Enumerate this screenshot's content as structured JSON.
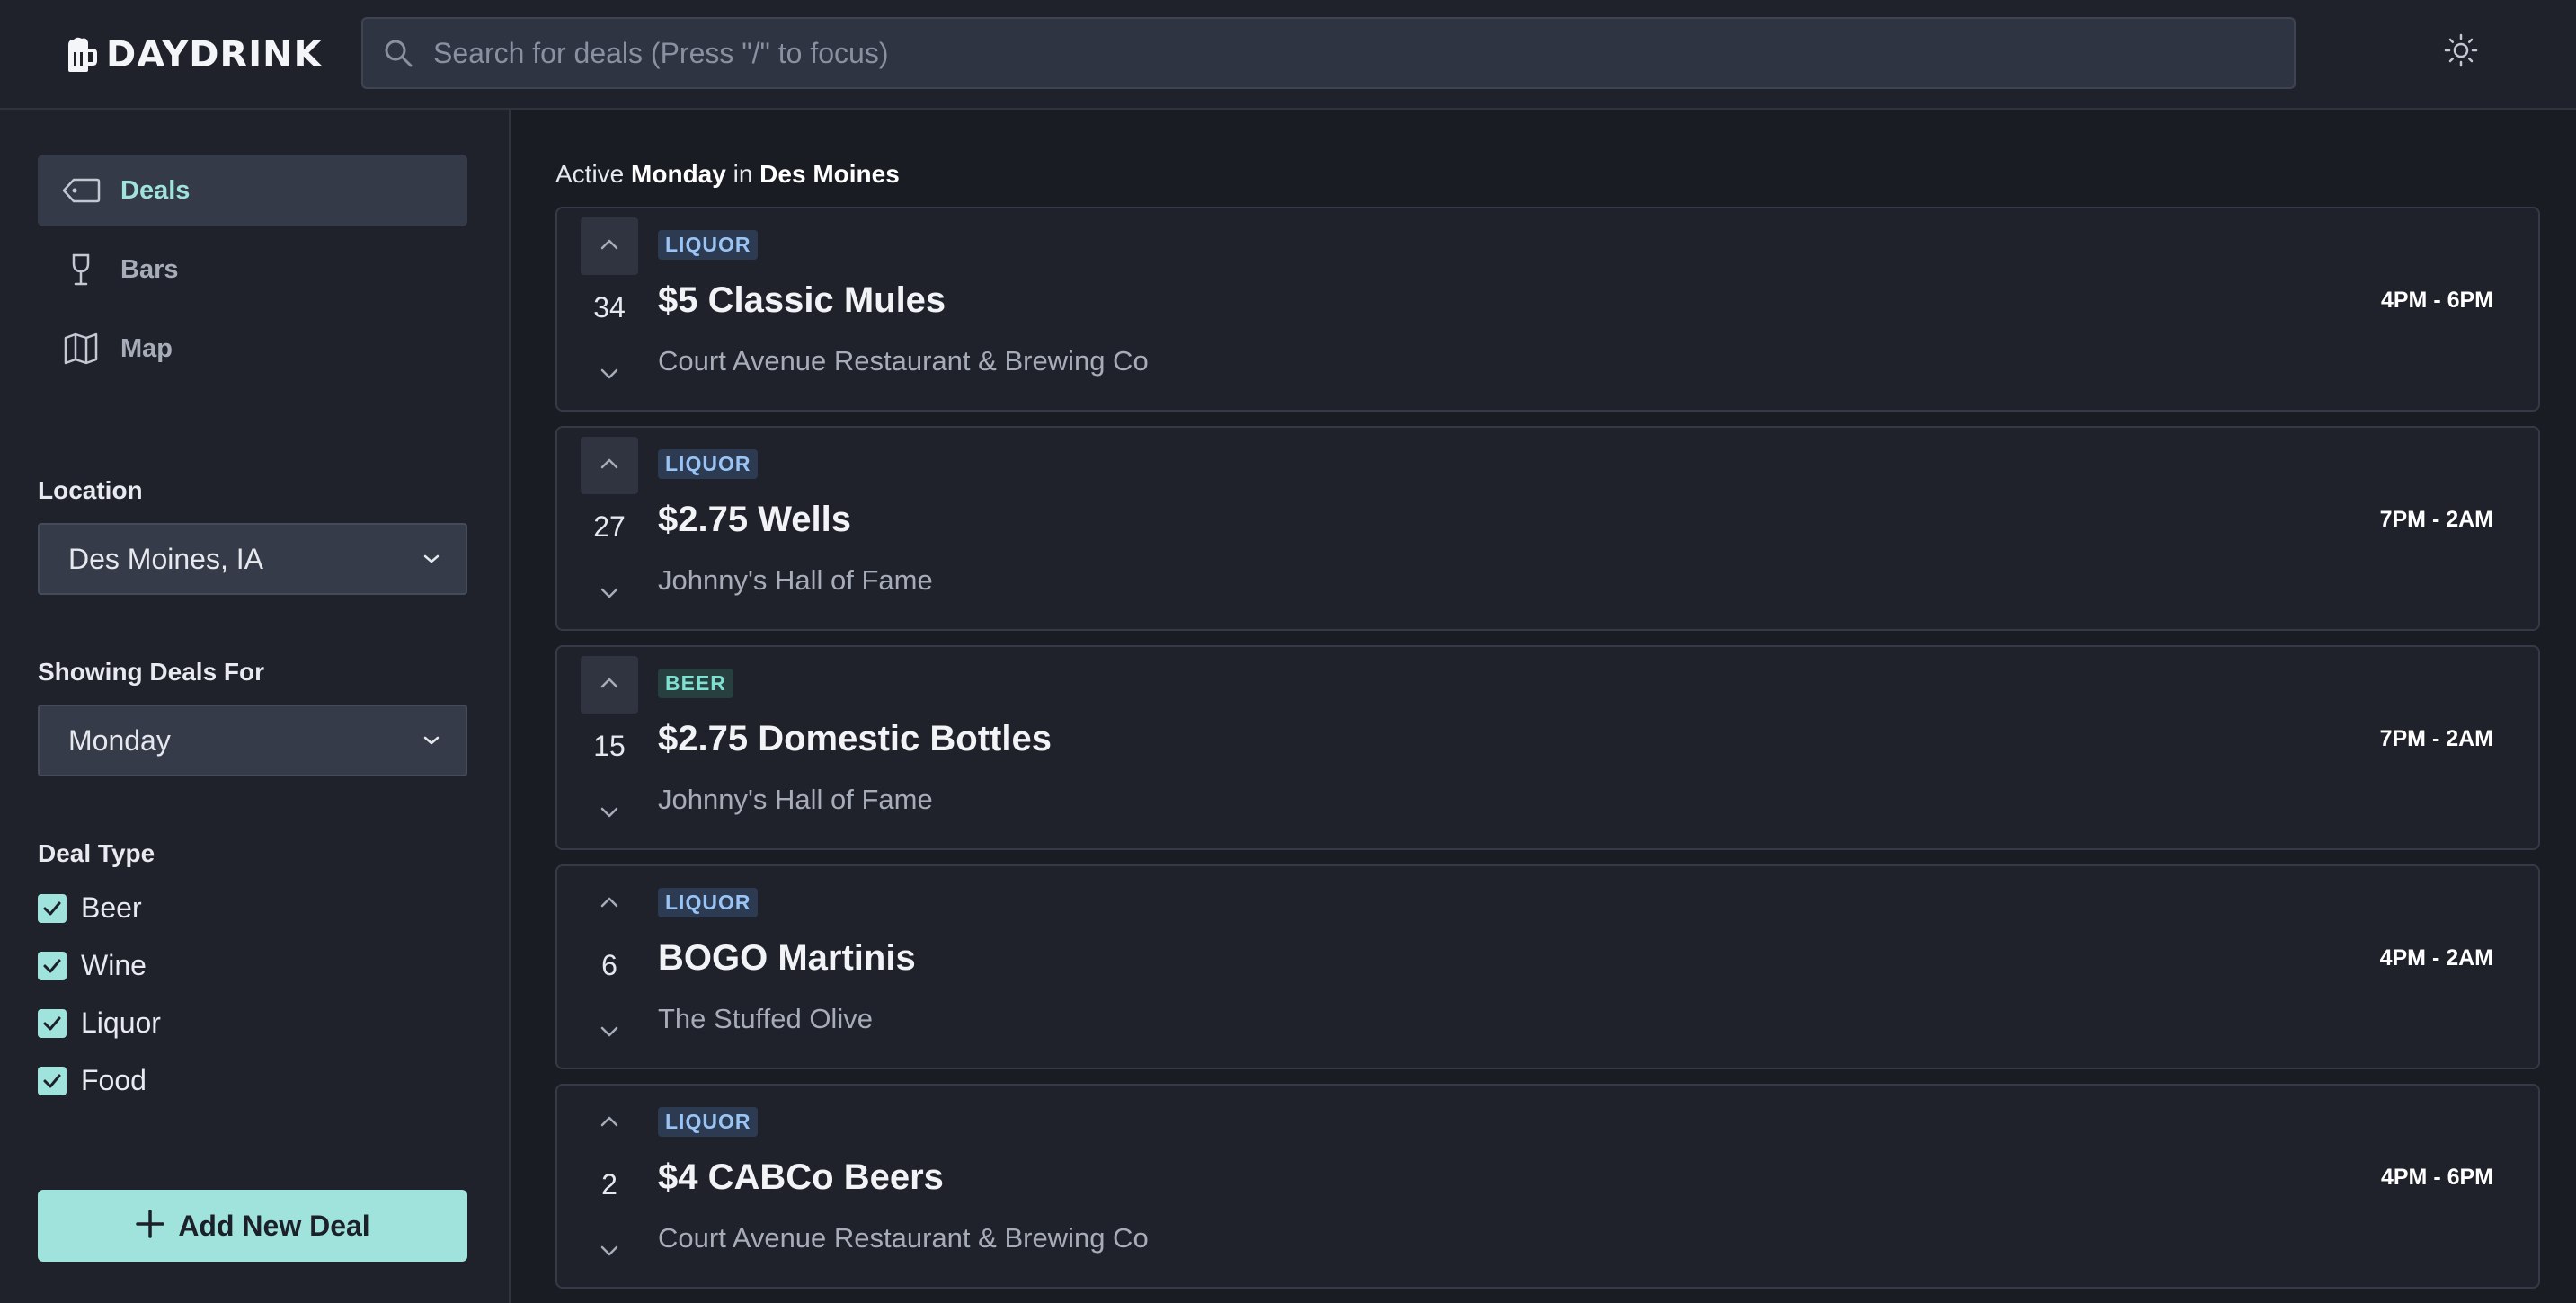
{
  "app": {
    "name": "DAYDRINK"
  },
  "search": {
    "placeholder": "Search for deals (Press \"/\" to focus)",
    "value": ""
  },
  "sidebar": {
    "nav": [
      {
        "label": "Deals",
        "icon": "tag-icon",
        "active": true
      },
      {
        "label": "Bars",
        "icon": "wine-glass-icon",
        "active": false
      },
      {
        "label": "Map",
        "icon": "map-icon",
        "active": false
      }
    ],
    "location": {
      "label": "Location",
      "value": "Des Moines, IA"
    },
    "day": {
      "label": "Showing Deals For",
      "value": "Monday"
    },
    "deal_type": {
      "label": "Deal Type",
      "options": [
        {
          "label": "Beer",
          "checked": true
        },
        {
          "label": "Wine",
          "checked": true
        },
        {
          "label": "Liquor",
          "checked": true
        },
        {
          "label": "Food",
          "checked": true
        }
      ]
    },
    "add_button": {
      "label": "Add New Deal"
    }
  },
  "main": {
    "active": {
      "prefix": "Active",
      "day": "Monday",
      "joiner": "in",
      "city": "Des Moines"
    },
    "deals": [
      {
        "votes": "34",
        "type": "LIQUOR",
        "title": "$5 Classic Mules",
        "bar": "Court Avenue Restaurant & Brewing Co",
        "time": "4PM - 6PM"
      },
      {
        "votes": "27",
        "type": "LIQUOR",
        "title": "$2.75 Wells",
        "bar": "Johnny's Hall of Fame",
        "time": "7PM - 2AM"
      },
      {
        "votes": "15",
        "type": "BEER",
        "title": "$2.75 Domestic Bottles",
        "bar": "Johnny's Hall of Fame",
        "time": "7PM - 2AM"
      },
      {
        "votes": "6",
        "type": "LIQUOR",
        "title": "BOGO Martinis",
        "bar": "The Stuffed Olive",
        "time": "4PM - 2AM"
      },
      {
        "votes": "2",
        "type": "LIQUOR",
        "title": "$4 CABCo Beers",
        "bar": "Court Avenue Restaurant & Brewing Co",
        "time": "4PM - 6PM"
      }
    ]
  },
  "colors": {
    "accent": "#9fe3dc",
    "background": "#1a1c24",
    "panel": "#1f222b",
    "liquor_badge": "#9ac4f5",
    "beer_badge": "#7ee0cf"
  }
}
